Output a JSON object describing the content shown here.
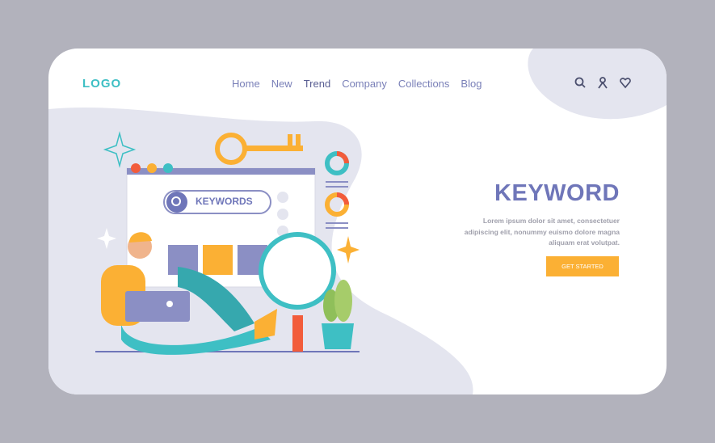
{
  "header": {
    "logo": "LOGO",
    "nav": [
      "Home",
      "New",
      "Trend",
      "Company",
      "Collections",
      "Blog"
    ],
    "active_nav": "Trend",
    "icons": [
      "search-icon",
      "user-icon",
      "heart-icon"
    ]
  },
  "hero": {
    "title": "KEYWORD",
    "description": "Lorem ipsum dolor sit amet, consectetuer adipiscing elit, nonummy euismo dolore magna aliquam erat volutpat.",
    "cta": "GET STARTED",
    "search_label": "KEYWORDS"
  },
  "colors": {
    "background": "#b2b2bc",
    "accent": "#6f76b9",
    "logo": "#3ebfc4",
    "cta": "#fbb034",
    "blob": "#e4e5ef"
  }
}
